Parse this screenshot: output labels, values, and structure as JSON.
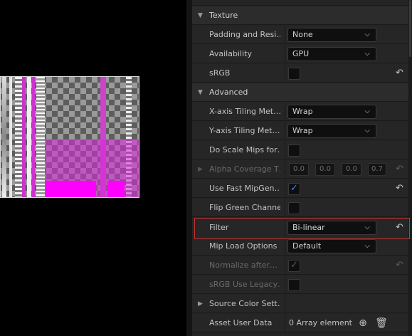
{
  "preview": {
    "label": "texture-preview"
  },
  "categories": {
    "texture": "Texture",
    "advanced": "Advanced"
  },
  "rows": {
    "padding": {
      "label": "Padding and Resi…",
      "value": "None"
    },
    "availability": {
      "label": "Availability",
      "value": "GPU"
    },
    "srgb": {
      "label": "sRGB"
    },
    "x_tiling": {
      "label": "X-axis Tiling Met…",
      "value": "Wrap"
    },
    "y_tiling": {
      "label": "Y-axis Tiling Met…",
      "value": "Wrap"
    },
    "scale_mips": {
      "label": "Do Scale Mips for…"
    },
    "alpha_coverage": {
      "label": "Alpha Coverage T…",
      "values": [
        "0.0",
        "0.0",
        "0.0",
        "0.7"
      ]
    },
    "fast_mip": {
      "label": "Use Fast MipGen…"
    },
    "flip_green": {
      "label": "Flip Green Channel"
    },
    "filter": {
      "label": "Filter",
      "value": "Bi-linear"
    },
    "mip_load": {
      "label": "Mip Load Options",
      "value": "Default"
    },
    "normalize": {
      "label": "Normalize after…"
    },
    "srgb_legacy": {
      "label": "sRGB Use Legacy…"
    },
    "source_color": {
      "label": "Source Color Sett…"
    },
    "asset_user_data": {
      "label": "Asset User Data",
      "value": "0 Array element"
    }
  },
  "icons": {
    "chevron": "chevron-down-icon",
    "reset": "reset-arrow-icon",
    "add": "plus-circle-icon",
    "delete": "trash-icon"
  },
  "colors": {
    "highlight": "#c43232",
    "check": "#3d8bff",
    "magenta": "#dc28dc"
  }
}
